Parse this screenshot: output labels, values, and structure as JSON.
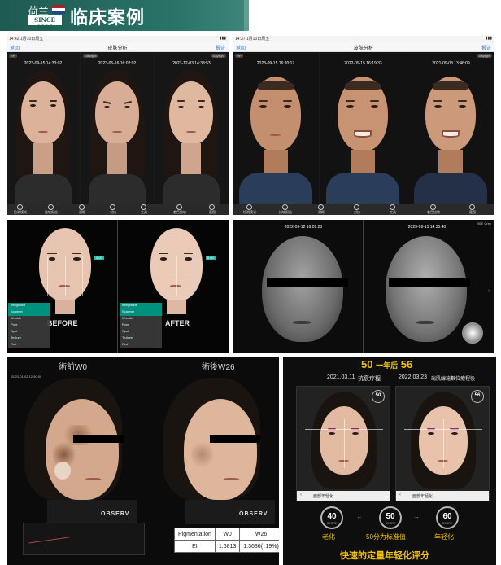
{
  "header": {
    "logo_text": "荷兰",
    "since": "SINCE 1996",
    "title": "临床案例",
    "flag_colors": [
      "#ae1c28",
      "#ffffff",
      "#21468b"
    ]
  },
  "case1": {
    "status_time": "14:42  1月10日周五",
    "nav_back": "返回",
    "nav_title": "皮肤分析",
    "nav_right": "报告",
    "panels": [
      {
        "mode": "RP",
        "timestamp": "2023-09-15 14:33:02"
      },
      {
        "mode": "Daylight",
        "timestamp": "2023-05-16 16:02:02"
      },
      {
        "mode": "Daylight",
        "timestamp": "2023-12-03 14:33:53"
      }
    ],
    "tools": [
      "检测模式",
      "比较报告",
      "测距",
      "对比",
      "工具",
      "着色比较",
      "截图"
    ]
  },
  "case2": {
    "status_time": "14:37  1月10日周五",
    "nav_back": "返回",
    "nav_title": "皮肤分析",
    "nav_right": "报告",
    "panels": [
      {
        "mode": "RP",
        "timestamp": "2023-09-15 16:20:17"
      },
      {
        "mode": "RP",
        "timestamp": "2022-09-15 16:19:33"
      },
      {
        "mode": "Daylight",
        "timestamp": "2021-09-08 13:46:09"
      }
    ],
    "tools": [
      "检测模式",
      "比较报告",
      "测距",
      "对比",
      "工具",
      "着色比较",
      "截图"
    ]
  },
  "case3": {
    "labels": [
      "BEFORE",
      "AFTER"
    ],
    "tags": [
      "0.00",
      "0.00"
    ],
    "side_items": [
      "Integrated",
      "Scanner",
      "Wrinkle",
      "Pore",
      "Spot",
      "Texture",
      "Red",
      "Oil"
    ]
  },
  "case4": {
    "timestamps": [
      "2022-09-12 16:09:23",
      "2023-09-15 14:35:40"
    ],
    "mode": "BSE Grey"
  },
  "case5": {
    "labels": [
      "術前W0",
      "術後W26"
    ],
    "timestamp": "2023-01-02 12:30:00",
    "brand": "OBSERV",
    "table": {
      "headers": [
        "Pigmentation",
        "W0",
        "W26"
      ],
      "row": [
        "EI",
        "1.6813",
        "1.3636(↓19%)"
      ]
    }
  },
  "case6": {
    "headline_left": "50",
    "headline_mid": "一年后",
    "headline_right": "56",
    "dates": [
      "2021.03.11",
      "2022.03.23"
    ],
    "captions": [
      "抗衰疗程",
      "瑞肌醇施數位療程後"
    ],
    "face_scores": [
      "50",
      "56"
    ],
    "bottom_buttons": [
      "面部年轻化",
      "面部年轻化"
    ],
    "scores": [
      {
        "value": "40",
        "label": "老化"
      },
      {
        "value": "50",
        "label": "50分为标准值"
      },
      {
        "value": "60",
        "label": "年轻化"
      }
    ],
    "score_sub": "SCORE",
    "footer": "快速的定量年轻化评分",
    "accent": "#f2c200"
  }
}
